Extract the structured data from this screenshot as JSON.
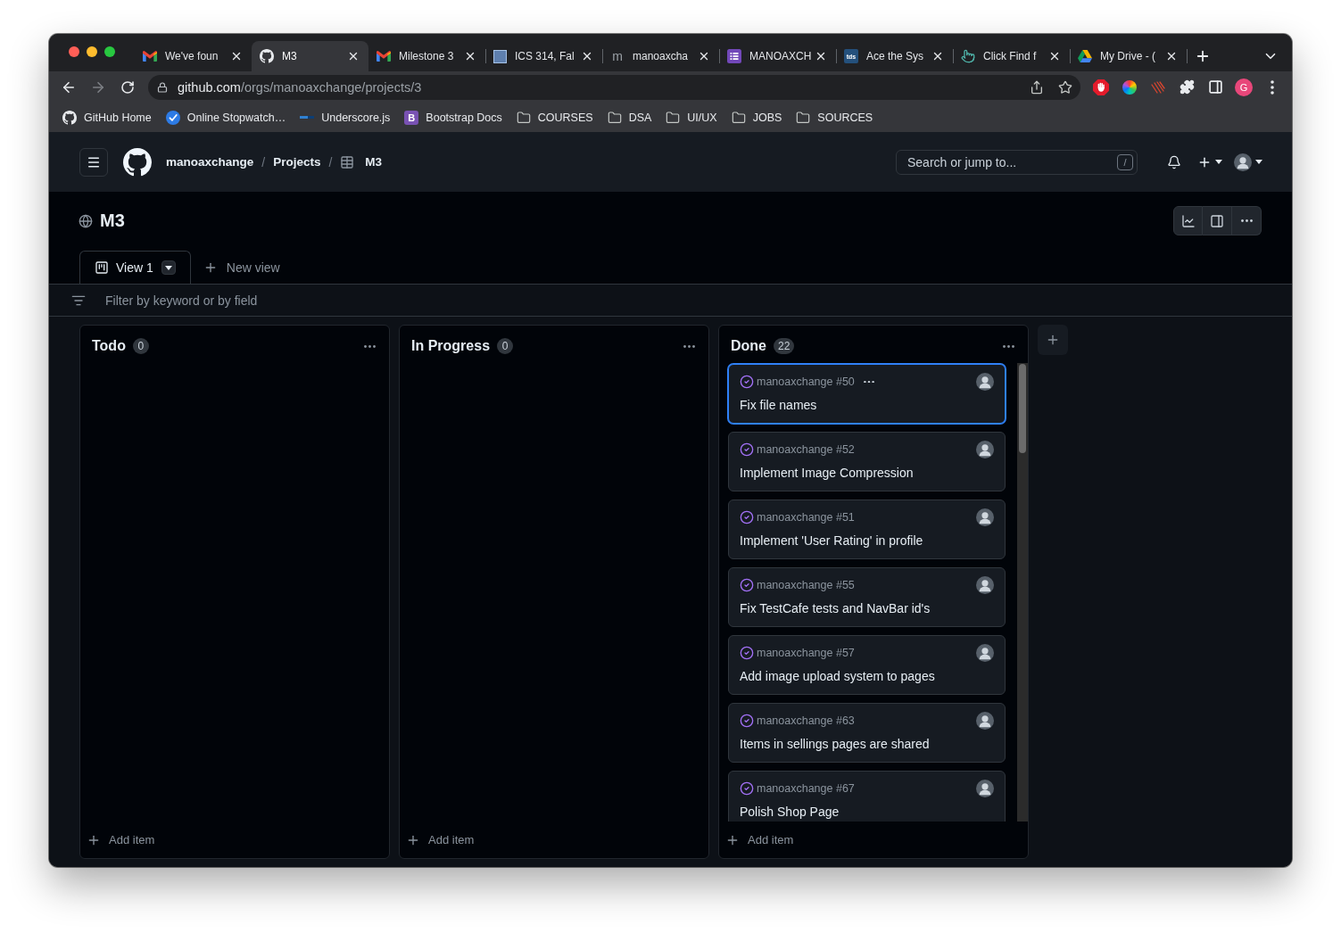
{
  "browser": {
    "tabs": [
      {
        "title": "We've foun",
        "selected": false
      },
      {
        "title": "M3",
        "selected": true
      },
      {
        "title": "Milestone 3",
        "selected": false
      },
      {
        "title": "ICS 314, Fal",
        "selected": false
      },
      {
        "favicon_text": "m",
        "title": "manoaxcha",
        "selected": false
      },
      {
        "title": "MANOAXCH",
        "selected": false
      },
      {
        "favicon_text": "tds",
        "title": "Ace the Sys",
        "selected": false
      },
      {
        "title": "Click Find f",
        "selected": false
      },
      {
        "title": "My Drive - (",
        "selected": false
      }
    ],
    "forward_disabled": true,
    "address": {
      "host": "github.com",
      "path": "/orgs/manoaxchange/projects/3"
    },
    "profile_initial": "G",
    "bookmarks": [
      {
        "label": "GitHub Home"
      },
      {
        "label": "Online Stopwatch…"
      },
      {
        "label": "Underscore.js"
      },
      {
        "icon_text": "B",
        "label": "Bootstrap Docs"
      },
      {
        "label": "COURSES"
      },
      {
        "label": "DSA"
      },
      {
        "label": "UI/UX"
      },
      {
        "label": "JOBS"
      },
      {
        "label": "SOURCES"
      }
    ]
  },
  "header": {
    "breadcrumbs": [
      {
        "kind": "link",
        "label": "manoaxchange"
      },
      {
        "kind": "separator",
        "label": "/"
      },
      {
        "kind": "link",
        "label": "Projects"
      },
      {
        "kind": "separator",
        "label": "/"
      },
      {
        "kind": "table",
        "label": "M3"
      }
    ],
    "search": {
      "placeholder": "Search or jump to...",
      "shortcut": "/"
    }
  },
  "project": {
    "title": "M3",
    "views": [
      {
        "label": "View 1",
        "selected": true
      }
    ],
    "new_view": "New view",
    "filter": {
      "placeholder": "Filter by keyword or by field"
    }
  },
  "board": {
    "columns": [
      {
        "name": "Todo",
        "count": "0",
        "add_label": "Add item"
      },
      {
        "name": "In Progress",
        "count": "0",
        "add_label": "Add item"
      },
      {
        "name": "Done",
        "count": "22",
        "add_label": "Add item",
        "cards": [
          {
            "repo": "manoaxchange #50",
            "title": "Fix file names",
            "selected": true
          },
          {
            "repo": "manoaxchange #52",
            "title": "Implement Image Compression",
            "selected": false
          },
          {
            "repo": "manoaxchange #51",
            "title": "Implement 'User Rating' in profile",
            "selected": false
          },
          {
            "repo": "manoaxchange #55",
            "title": "Fix TestCafe tests and NavBar id's",
            "selected": false
          },
          {
            "repo": "manoaxchange #57",
            "title": "Add image upload system to pages",
            "selected": false
          },
          {
            "repo": "manoaxchange #63",
            "title": "Items in sellings pages are shared",
            "selected": false
          },
          {
            "repo": "manoaxchange #67",
            "title": "Polish Shop Page",
            "selected": false
          }
        ]
      }
    ]
  }
}
